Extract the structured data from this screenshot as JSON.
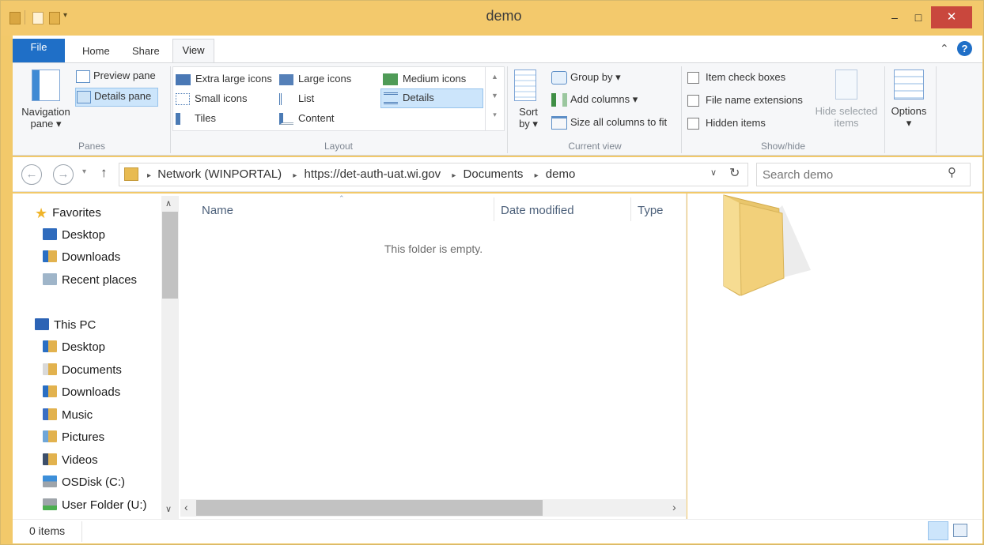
{
  "window": {
    "title": "demo",
    "minimize_glyph": "–",
    "maximize_glyph": "□",
    "close_glyph": "✕",
    "accent_color": "#f3c96c",
    "close_color": "#c9473d"
  },
  "ribbon_tabs": {
    "file": "File",
    "home": "Home",
    "share": "Share",
    "view": "View",
    "file_color": "#1f6fc7"
  },
  "ribbon": {
    "panes": {
      "navigation_pane": "Navigation",
      "navigation_pane_line2": "pane ▾",
      "preview_pane": "Preview pane",
      "details_pane": "Details pane",
      "group_label": "Panes"
    },
    "layout": {
      "extra_large_icons": "Extra large icons",
      "large_icons": "Large icons",
      "medium_icons": "Medium icons",
      "small_icons": "Small icons",
      "list": "List",
      "details": "Details",
      "tiles": "Tiles",
      "content": "Content",
      "group_label": "Layout"
    },
    "current_view": {
      "sort_by": "Sort",
      "sort_by_line2": "by ▾",
      "group_by": "Group by ▾",
      "add_columns": "Add columns ▾",
      "size_all_columns": "Size all columns to fit",
      "group_label": "Current view"
    },
    "show_hide": {
      "item_check_boxes": "Item check boxes",
      "file_name_extensions": "File name extensions",
      "hidden_items": "Hidden items",
      "hide_selected": "Hide selected",
      "hide_selected_line2": "items",
      "options": "Options",
      "options_arrow": "▾",
      "group_label": "Show/hide"
    }
  },
  "address_bar": {
    "segments": [
      "Network (WINPORTAL)",
      "https://det-auth-uat.wi.gov",
      "Documents",
      "demo"
    ],
    "search_placeholder": "Search demo"
  },
  "nav_pane": {
    "favorites": "Favorites",
    "favorites_items": [
      "Desktop",
      "Downloads",
      "Recent places"
    ],
    "this_pc": "This PC",
    "this_pc_items": [
      "Desktop",
      "Documents",
      "Downloads",
      "Music",
      "Pictures",
      "Videos",
      "OSDisk (C:)",
      "User Folder (U:)"
    ]
  },
  "file_list": {
    "columns": [
      "Name",
      "Date modified",
      "Type"
    ],
    "empty_message": "This folder is empty."
  },
  "status_bar": {
    "item_count": "0 items"
  }
}
